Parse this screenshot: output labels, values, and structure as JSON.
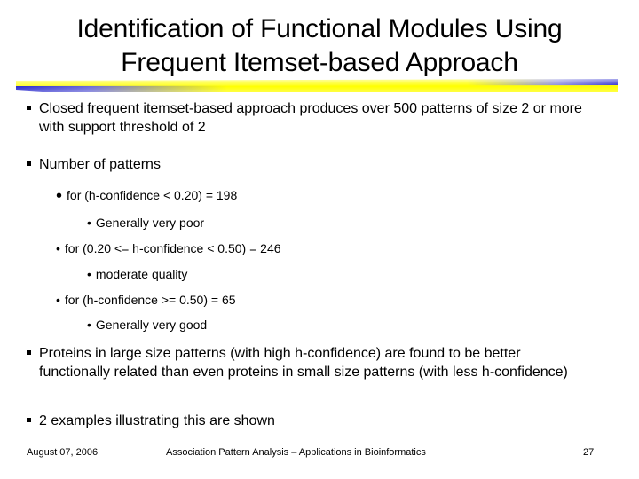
{
  "slide": {
    "title_line1": "Identification of Functional Modules Using",
    "title_line2": "Frequent Itemset-based Approach",
    "colors": {
      "bar_yellow": "#ffff00",
      "bar_blue": "#2b2bcf",
      "text": "#000000"
    },
    "bullets": [
      {
        "text": "Closed frequent itemset-based approach produces over 500 patterns of size 2 or more with support threshold of 2"
      },
      {
        "text": "Number of patterns",
        "sub": [
          {
            "text": "for (h-confidence < 0.20) = 198",
            "note": "Generally very poor"
          },
          {
            "text": "for (0.20 <= h-confidence < 0.50) =  246",
            "note": "moderate quality"
          },
          {
            "text": "for (h-confidence >= 0.50) = 65",
            "note": "Generally very good"
          }
        ]
      },
      {
        "text": "Proteins in large size patterns (with high h-confidence) are found to be better functionally related than even proteins in small size patterns (with less h-confidence)"
      },
      {
        "text": "2 examples illustrating this are shown"
      }
    ],
    "footer": {
      "date": "August 07, 2006",
      "center": "Association Pattern Analysis – Applications in Bioinformatics",
      "page_number": "27"
    }
  }
}
